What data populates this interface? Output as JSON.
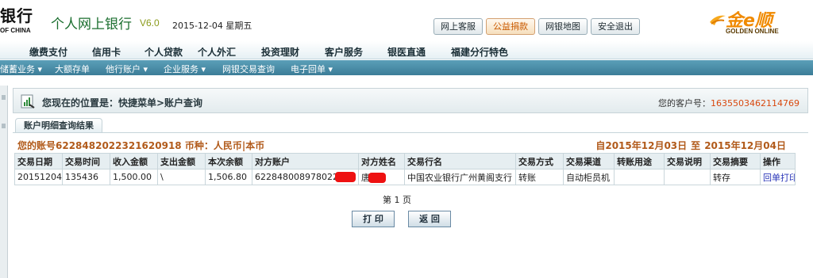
{
  "header": {
    "bank_name": "银行",
    "bank_name_en": "OF CHINA",
    "site_title": "个人网上银行",
    "version": "V6.0",
    "date": "2015-12-04 星期五",
    "top_buttons": [
      "网上客服",
      "公益捐款",
      "网银地图",
      "安全退出"
    ],
    "partner_logo_cn": "金e顺",
    "partner_logo_en": "GOLDEN ONLINE"
  },
  "main_nav": [
    "缴费支付",
    "信用卡",
    "个人贷款",
    "个人外汇",
    "投资理财",
    "客户服务",
    "银医直通",
    "福建分行特色"
  ],
  "sub_nav": [
    "储蓄业务 ▾",
    "大额存单",
    "他行账户 ▾",
    "企业服务 ▾",
    "网银交易查询",
    "电子回单 ▾"
  ],
  "location": {
    "label": "您现在的位置是：快捷菜单>账户查询",
    "customer_label": "您的客户号：",
    "customer_no": "1635503462114769"
  },
  "tab": "账户明细查询结果",
  "account_line": "您的账号6228482022321620918 币种：人民币|本币",
  "range": {
    "from": "自2015年12月03日",
    "sep": "至",
    "to": "2015年12月04日"
  },
  "table": {
    "headers": [
      "交易日期",
      "交易时间",
      "收入金额",
      "支出金额",
      "本次余额",
      "对方账户",
      "对方姓名",
      "交易行名",
      "交易方式",
      "交易渠道",
      "转账用途",
      "交易说明",
      "交易摘要",
      "操作"
    ],
    "rows": [
      {
        "date": "20151204",
        "time": "135436",
        "income": "1,500.00",
        "expense": "\\",
        "balance": "1,506.80",
        "peer_account": "622848008978022",
        "peer_name": "唐",
        "bank_name": "中国农业银行广州黄阁支行",
        "method": "转账",
        "channel": "自动柜员机",
        "purpose": "",
        "note": "",
        "summary": "转存",
        "action": "回单打印"
      }
    ]
  },
  "page_info": "第 1 页",
  "buttons": {
    "print": "打 印",
    "back": "返 回"
  },
  "colors": {
    "accent_orange": "#d8480e",
    "title_green": "#1a6e2e",
    "subnav_blue": "#4a8eaa"
  }
}
